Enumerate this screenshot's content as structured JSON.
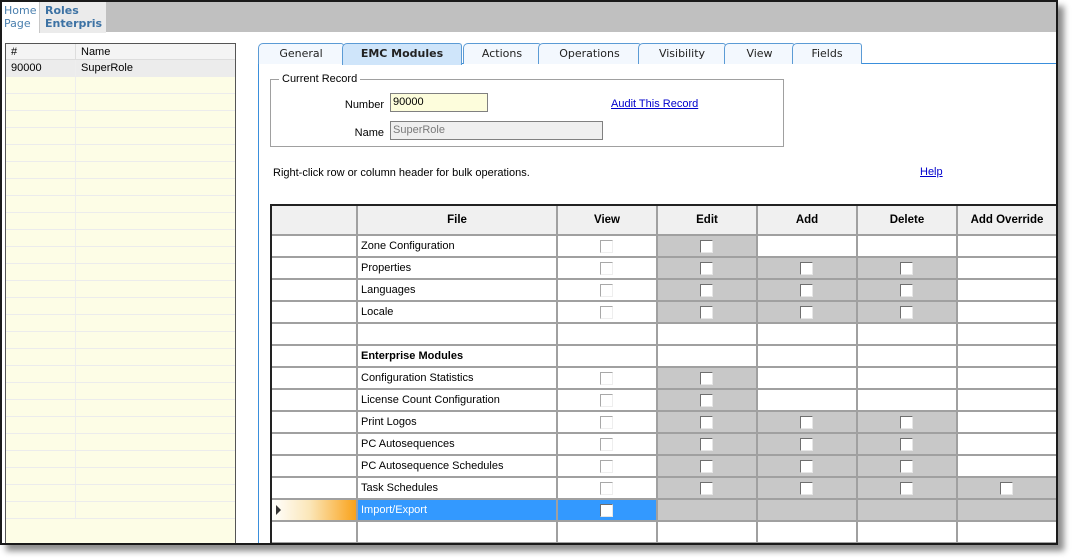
{
  "top_tabs": {
    "home": "Home Page",
    "roles": "Roles Enterpris"
  },
  "role_list": {
    "columns": [
      "#",
      "Name"
    ],
    "rows": [
      {
        "number": "90000",
        "name": "SuperRole",
        "selected": true
      }
    ],
    "empty_rows": 26
  },
  "tabs": [
    {
      "label": "General",
      "active": false
    },
    {
      "label": "EMC Modules",
      "active": true
    },
    {
      "label": "Actions",
      "active": false
    },
    {
      "label": "Operations",
      "active": false
    },
    {
      "label": "Visibility",
      "active": false
    },
    {
      "label": "View",
      "active": false
    },
    {
      "label": "Fields",
      "active": false
    }
  ],
  "current_record": {
    "legend": "Current Record",
    "number_label": "Number",
    "number_value": "90000",
    "name_label": "Name",
    "name_value": "SuperRole",
    "audit_link": "Audit This Record"
  },
  "hint": "Right-click row or column header for bulk operations.",
  "help_link": "Help",
  "grid": {
    "columns": [
      "File",
      "View",
      "Edit",
      "Add",
      "Delete",
      "Add Override"
    ],
    "rows": [
      {
        "file": "Zone Configuration",
        "bold": false,
        "view": "box",
        "edit": "gray-box",
        "add": "white",
        "delete": "white",
        "add_override": "white"
      },
      {
        "file": "Properties",
        "bold": false,
        "view": "box",
        "edit": "gray-box",
        "add": "gray-box",
        "delete": "gray-box",
        "add_override": "white"
      },
      {
        "file": "Languages",
        "bold": false,
        "view": "box",
        "edit": "gray-box",
        "add": "gray-box",
        "delete": "gray-box",
        "add_override": "white"
      },
      {
        "file": "Locale",
        "bold": false,
        "view": "box",
        "edit": "gray-box",
        "add": "gray-box",
        "delete": "gray-box",
        "add_override": "white"
      },
      {
        "file": "",
        "bold": false,
        "view": "white",
        "edit": "white",
        "add": "white",
        "delete": "white",
        "add_override": "white"
      },
      {
        "file": "Enterprise Modules",
        "bold": true,
        "view": "white",
        "edit": "white",
        "add": "white",
        "delete": "white",
        "add_override": "white"
      },
      {
        "file": "Configuration Statistics",
        "bold": false,
        "view": "box",
        "edit": "gray-box",
        "add": "white",
        "delete": "white",
        "add_override": "white"
      },
      {
        "file": "License Count Configuration",
        "bold": false,
        "view": "box",
        "edit": "gray-box",
        "add": "white",
        "delete": "white",
        "add_override": "white"
      },
      {
        "file": "Print Logos",
        "bold": false,
        "view": "box",
        "edit": "gray-box",
        "add": "gray-box",
        "delete": "gray-box",
        "add_override": "white"
      },
      {
        "file": "PC Autosequences",
        "bold": false,
        "view": "box",
        "edit": "gray-box",
        "add": "gray-box",
        "delete": "gray-box",
        "add_override": "white"
      },
      {
        "file": "PC Autosequence Schedules",
        "bold": false,
        "view": "box",
        "edit": "gray-box",
        "add": "gray-box",
        "delete": "gray-box",
        "add_override": "white"
      },
      {
        "file": "Task Schedules",
        "bold": false,
        "view": "box",
        "edit": "gray-box",
        "add": "gray-box",
        "delete": "gray-box",
        "add_override": "gray-box"
      },
      {
        "file": "Import/Export",
        "bold": false,
        "current": true,
        "view": "box",
        "edit": "gray",
        "add": "gray",
        "delete": "gray",
        "add_override": "gray"
      },
      {
        "file": "",
        "bold": false,
        "view": "white",
        "edit": "white",
        "add": "white",
        "delete": "white",
        "add_override": "white"
      }
    ]
  },
  "colors": {
    "selection_blue": "#3399ff",
    "tab_border": "#5b9bd5",
    "link": "#0000cc",
    "list_bg": "#fdfde6",
    "disabled_cell": "#c8c8c8"
  }
}
